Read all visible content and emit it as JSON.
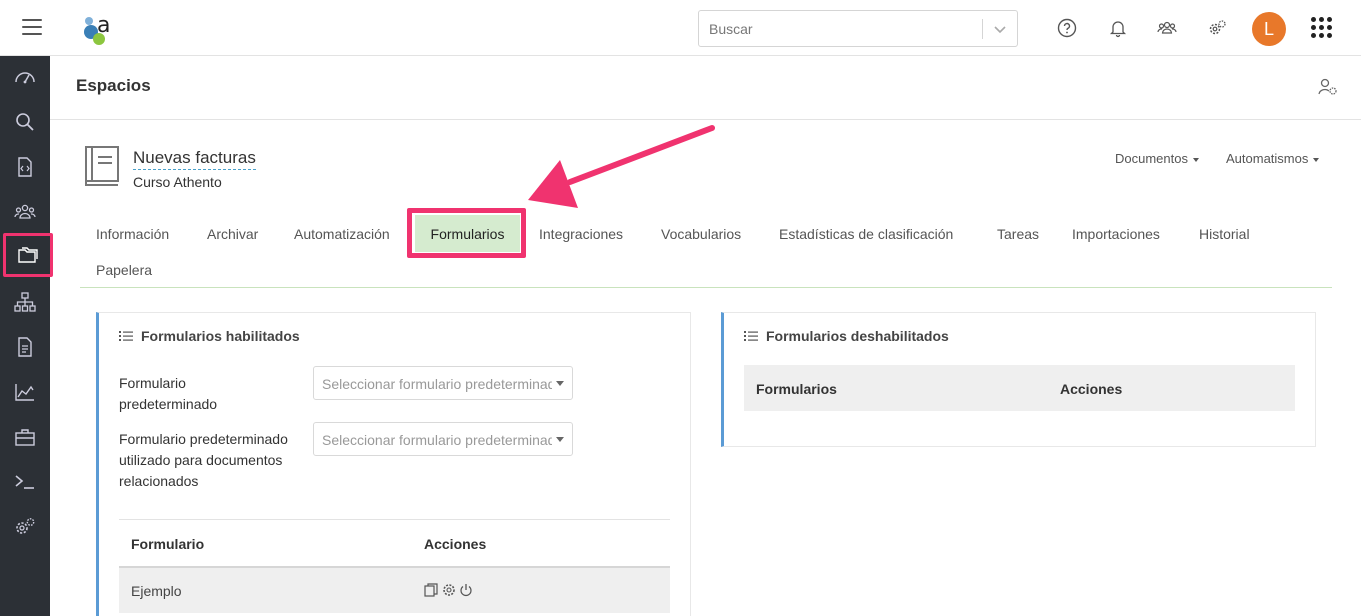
{
  "topbar": {
    "search_placeholder": "Buscar",
    "avatar_initial": "L",
    "avatar_color": "#e8782a"
  },
  "page": {
    "title": "Espacios"
  },
  "space": {
    "name": "Nuevas facturas",
    "subtitle": "Curso Athento",
    "menus": [
      "Documentos",
      "Automatismos"
    ]
  },
  "tabs": {
    "items": [
      "Información",
      "Archivar",
      "Automatización",
      "Formularios",
      "Integraciones",
      "Vocabularios",
      "Estadísticas de clasificación",
      "Tareas",
      "Importaciones",
      "Historial",
      "Papelera"
    ],
    "active": "Formularios"
  },
  "enabled_panel": {
    "title": "Formularios habilitados",
    "field1_label": "Formulario predeterminado",
    "field1_placeholder": "Seleccionar formulario predeterminado",
    "field2_label": "Formulario predeterminado utilizado para documentos relacionados",
    "field2_placeholder": "Seleccionar formulario predeterminado",
    "col_form": "Formulario",
    "col_actions": "Acciones",
    "rows": [
      {
        "name": "Ejemplo"
      }
    ]
  },
  "disabled_panel": {
    "title": "Formularios deshabilitados",
    "col_form": "Formularios",
    "col_actions": "Acciones"
  },
  "colors": {
    "highlight": "#f0336f",
    "active_tab_bg": "#d5ebcf",
    "sidebar_bg": "#2c3036",
    "panel_accent": "#5b9bd5"
  }
}
